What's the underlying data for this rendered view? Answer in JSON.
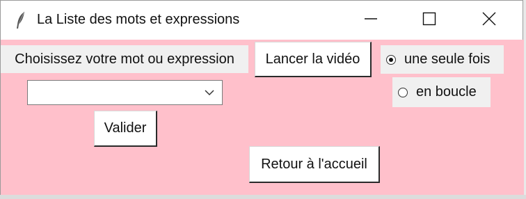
{
  "window": {
    "title": "La Liste des mots et expressions",
    "icon": "feather-icon",
    "controls": [
      "minimize-icon",
      "maximize-icon",
      "close-icon"
    ]
  },
  "form": {
    "choose_label": "Choisissez votre mot ou expression",
    "combo_value": "",
    "validate_label": "Valider",
    "play_video_label": "Lancer la vidéo",
    "home_label": "Retour à l'accueil"
  },
  "playback": {
    "options": [
      {
        "label": "une seule fois",
        "checked": true
      },
      {
        "label": "en boucle",
        "checked": false
      }
    ]
  },
  "colors": {
    "background": "#ffc0cb",
    "label_bg": "#f0f0f0"
  }
}
